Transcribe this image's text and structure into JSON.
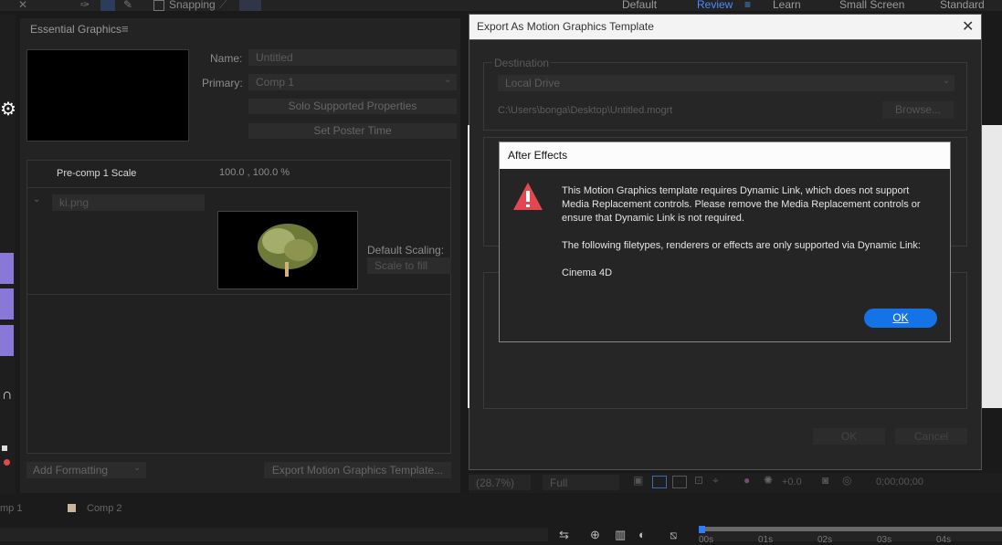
{
  "workspace_bar": {
    "snapping_label": "Snapping",
    "workspaces": [
      "Default",
      "Review",
      "Learn",
      "Small Screen",
      "Standard"
    ],
    "active": "Review"
  },
  "essential_graphics": {
    "title": "Essential Graphics",
    "name_label": "Name:",
    "name_value": "Untitled",
    "primary_label": "Primary:",
    "primary_value": "Comp 1",
    "solo_button": "Solo Supported Properties",
    "poster_button": "Set Poster Time",
    "property_label": "Pre-comp 1 Scale",
    "property_value": "100.0 , 100.0 %",
    "media_name": "ki.png",
    "default_scaling_label": "Default Scaling:",
    "default_scaling_value": "Scale to fill",
    "add_formatting": "Add Formatting",
    "export_button": "Export Motion Graphics Template..."
  },
  "export_dialog": {
    "title": "Export As Motion Graphics Template",
    "destination_label": "Destination",
    "destination_value": "Local Drive",
    "path": "C:\\Users\\bonga\\Desktop\\Untitled.mogrt",
    "browse": "Browse...",
    "ok": "OK",
    "cancel": "Cancel"
  },
  "alert": {
    "title": "After Effects",
    "message_1": "This Motion Graphics template requires Dynamic Link, which does not support Media Replacement controls. Please remove the Media Replacement controls or ensure that Dynamic Link is not required.",
    "message_2": " The following filetypes, renderers or effects are only supported via Dynamic Link:",
    "message_3": "Cinema 4D",
    "ok": "OK"
  },
  "viewer_bar": {
    "zoom": "(28.7%)",
    "resolution": "Full",
    "exposure": "+0.0",
    "timecode": "0;00;00;00"
  },
  "timeline": {
    "tab_1": "mp 1",
    "tab_2": "Comp 2",
    "ticks": [
      "00s",
      "01s",
      "02s",
      "03s",
      "04s"
    ]
  },
  "colors": {
    "accent": "#1473e6",
    "warning": "#e34850"
  }
}
